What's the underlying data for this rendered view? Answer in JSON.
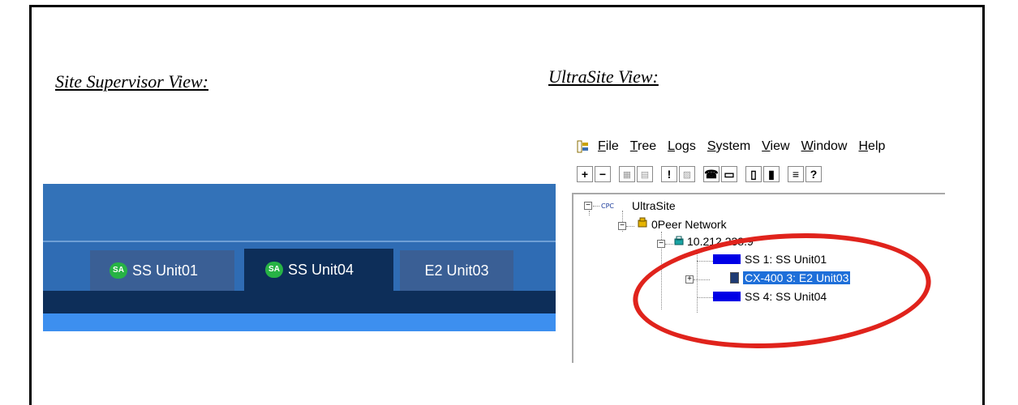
{
  "captions": {
    "left": "Site Supervisor View:",
    "right": "UltraSite View:"
  },
  "site_supervisor": {
    "tabs": [
      {
        "badge": "SA",
        "label": "SS Unit01",
        "active": false
      },
      {
        "badge": "SA",
        "label": "SS Unit04",
        "active": true
      },
      {
        "badge": "",
        "label": "E2 Unit03",
        "active": false
      }
    ],
    "colors": {
      "header": "#3372b8",
      "active_tab": "#0d2e59",
      "badge": "#27b345",
      "bottom_bar": "#3d8fef"
    }
  },
  "ultrasite": {
    "menu": [
      {
        "label": "File",
        "accel": "F",
        "rest": "ile"
      },
      {
        "label": "Tree",
        "accel": "T",
        "rest": "ree"
      },
      {
        "label": "Logs",
        "accel": "L",
        "rest": "ogs"
      },
      {
        "label": "System",
        "accel": "S",
        "rest": "ystem"
      },
      {
        "label": "View",
        "accel": "V",
        "rest": "iew"
      },
      {
        "label": "Window",
        "accel": "W",
        "rest": "indow"
      },
      {
        "label": "Help",
        "accel": "H",
        "rest": "elp"
      }
    ],
    "toolbar_icons": [
      "plus-icon",
      "minus-icon",
      "site-icon",
      "graph-icon",
      "alarm-icon",
      "chart-icon",
      "phone-icon",
      "monitor-icon",
      "connect-icon",
      "disconnect-icon",
      "list-icon",
      "help-icon"
    ],
    "tree": {
      "root_tag": "CPC",
      "root": "UltraSite",
      "network": "0Peer Network",
      "ip": "10.212.238.9",
      "units": [
        {
          "label": "SS 1: SS Unit01",
          "selected": false
        },
        {
          "label": "CX-400 3: E2 Unit03",
          "selected": true
        },
        {
          "label": "SS 4: SS Unit04",
          "selected": false
        }
      ]
    },
    "highlight_color": "#e0231c"
  }
}
